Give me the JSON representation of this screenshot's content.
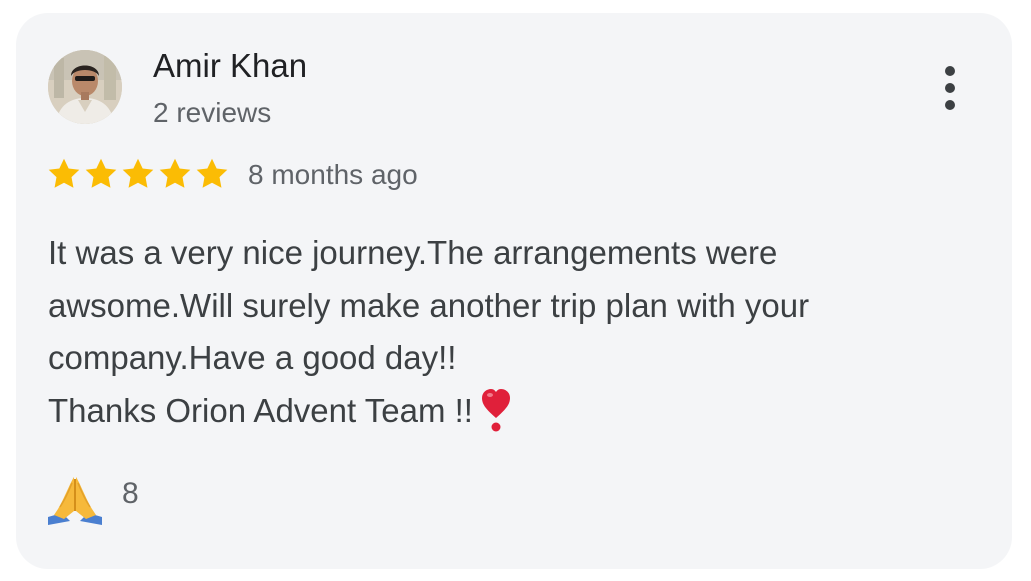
{
  "review": {
    "author_name": "Amir Khan",
    "author_reviews": "2 reviews",
    "rating": 5,
    "rating_max": 5,
    "time_ago": "8 months ago",
    "text_lines": [
      "It was a very nice journey.The arrangements were",
      "awsome.Will surely make another trip plan with your",
      "company.Have a good day!!",
      "Thanks Orion Advent Team !!"
    ],
    "heart_emoji": "heart-exclamation-icon",
    "reaction_icon": "folded-hands-icon",
    "reaction_count": "8",
    "more_icon": "more-vertical-icon"
  },
  "colors": {
    "card_bg": "#f4f5f7",
    "star": "#fbbc04",
    "heart": "#e0203a",
    "text_primary": "#202124",
    "text_secondary": "#5f6368"
  }
}
